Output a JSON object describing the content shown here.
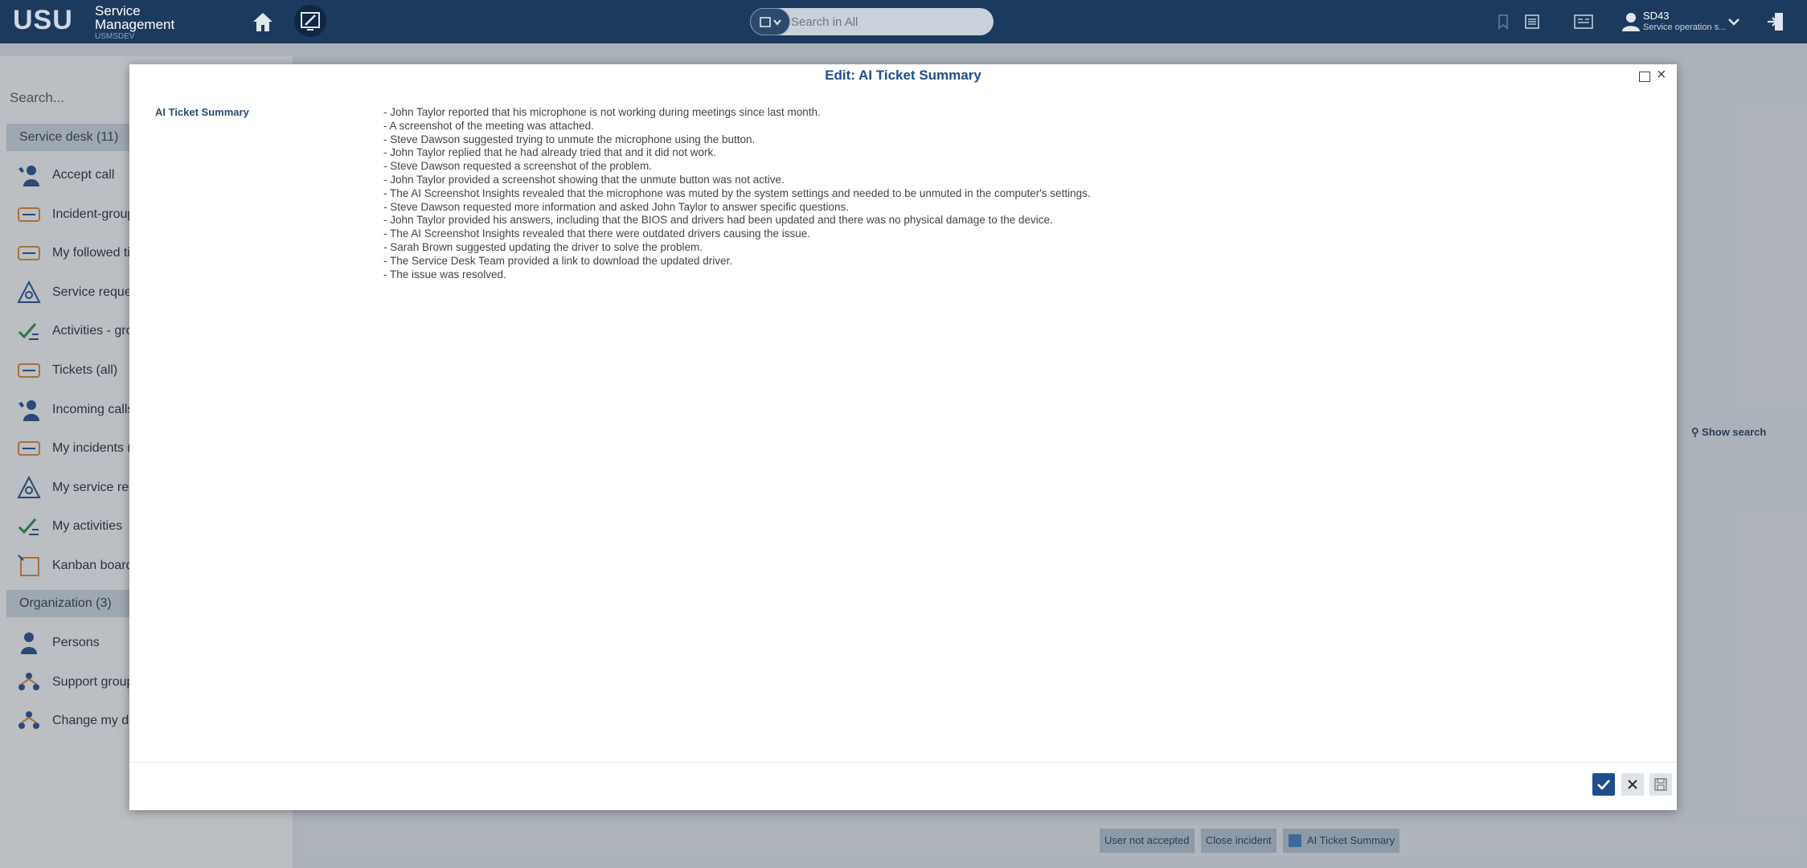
{
  "header": {
    "logo": "USU",
    "brand_line1": "Service",
    "brand_line2": "Management",
    "instance": "USMSDEV",
    "search_placeholder": "Search in All",
    "user_name": "SD43",
    "user_role": "Service operation s..."
  },
  "left_panel": {
    "search_placeholder": "Search...",
    "service_desk_header": "Service desk (11)",
    "service_desk_items": [
      {
        "label": "Accept call",
        "icon": "phone-user-icon"
      },
      {
        "label": "Incident-group",
        "icon": "ticket-icon"
      },
      {
        "label": "My followed ti",
        "icon": "ticket-icon"
      },
      {
        "label": "Service reques",
        "icon": "service-request-icon"
      },
      {
        "label": "Activities - gro",
        "icon": "checklist-icon"
      },
      {
        "label": "Tickets (all)",
        "icon": "ticket-icon"
      },
      {
        "label": "Incoming calls",
        "icon": "phone-user-icon"
      },
      {
        "label": "My incidents (",
        "icon": "ticket-icon"
      },
      {
        "label": "My service rec",
        "icon": "service-request-icon"
      },
      {
        "label": "My activities",
        "icon": "checklist-icon"
      },
      {
        "label": "Kanban board",
        "icon": "kanban-icon"
      }
    ],
    "organization_header": "Organization (3)",
    "organization_items": [
      {
        "label": "Persons",
        "icon": "person-icon"
      },
      {
        "label": "Support group",
        "icon": "group-icon"
      },
      {
        "label": "Change my de",
        "icon": "group-icon"
      }
    ]
  },
  "main_panel": {
    "show_search": "Show search",
    "bottom_buttons": [
      "User not accepted",
      "Close incident",
      "AI Ticket Summary"
    ]
  },
  "dialog": {
    "title": "Edit: AI Ticket Summary",
    "field_label": "AI Ticket Summary",
    "summary_lines": [
      "- John Taylor reported that his microphone is not working during meetings since last month.",
      "- A screenshot of the meeting was attached.",
      "- Steve Dawson suggested trying to unmute the microphone using the button.",
      "- John Taylor replied that he had already tried that and it did not work.",
      "- Steve Dawson requested a screenshot of the problem.",
      "- John Taylor provided a screenshot showing that the unmute button was not active.",
      "- The AI Screenshot Insights revealed that the microphone was muted by the system settings and needed to be unmuted in the computer's settings.",
      "- Steve Dawson requested more information and asked John Taylor to answer specific questions.",
      "- John Taylor provided his answers, including that the BIOS and drivers had been updated and there was no physical damage to the device.",
      "- The AI Screenshot Insights revealed that there were outdated drivers causing the issue.",
      "- Sarah Brown suggested updating the driver to solve the problem.",
      "- The Service Desk Team provided a link to download the updated driver.",
      "- The issue was resolved."
    ]
  }
}
